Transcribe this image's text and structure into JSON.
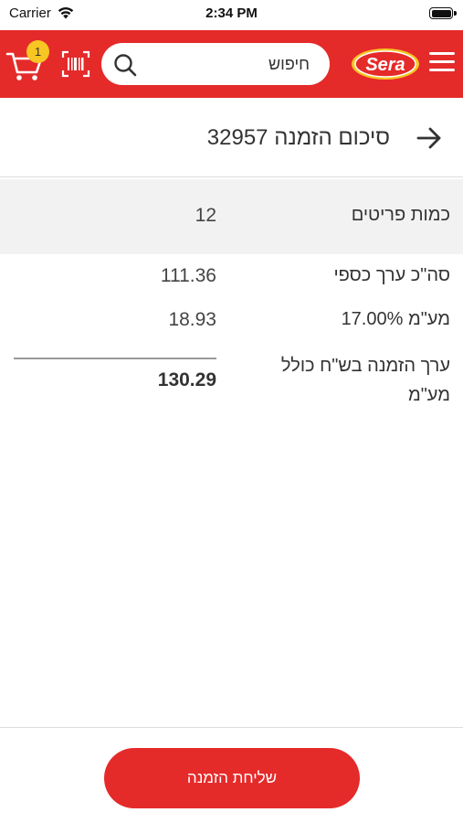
{
  "status_bar": {
    "carrier": "Carrier",
    "time": "2:34 PM"
  },
  "header": {
    "cart_count": "1",
    "search_placeholder": "חיפוש",
    "logo_text": "Sera",
    "brand_color": "#e52a2a",
    "badge_color": "#f7c623"
  },
  "page": {
    "title": "סיכום הזמנה 32957"
  },
  "summary": {
    "items_label": "כמות פריטים",
    "items_value": "12",
    "net_label": "סה\"כ ערך כספי",
    "net_value": "111.36",
    "vat_label": "מע\"מ 17.00%",
    "vat_value": "18.93",
    "total_label": "ערך הזמנה בש\"ח כולל מע\"מ",
    "total_value": "130.29"
  },
  "footer": {
    "submit_label": "שליחת הזמנה"
  },
  "icons": {
    "cart": "cart-icon",
    "barcode": "barcode-scan-icon",
    "search": "search-icon",
    "menu": "hamburger-menu-icon",
    "back": "arrow-right-icon"
  }
}
